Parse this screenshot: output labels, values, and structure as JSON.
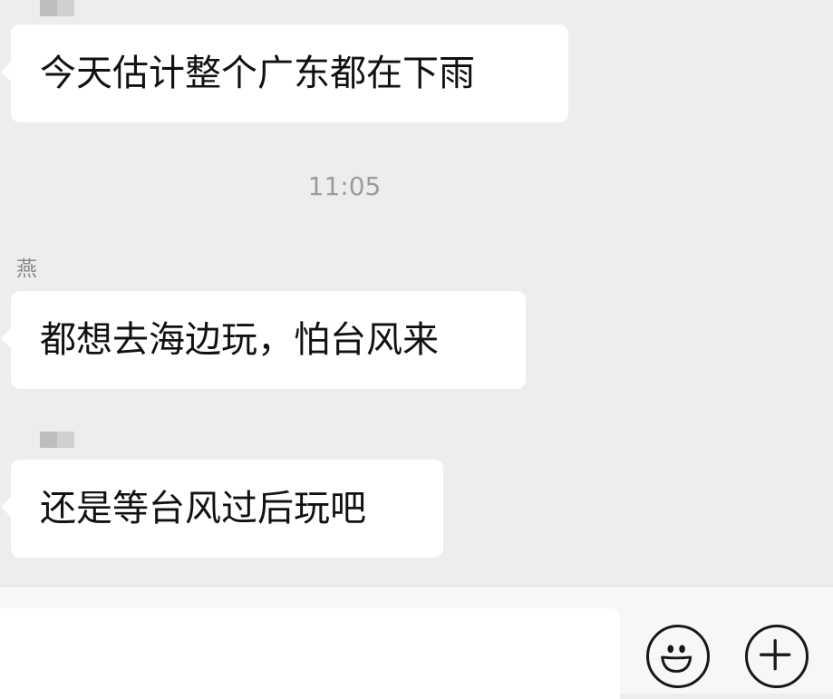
{
  "messages": [
    {
      "sender": "",
      "sender_blurred": true,
      "text": "今天估计整个广东都在下雨"
    },
    {
      "sender": "燕",
      "sender_blurred": false,
      "text": "都想去海边玩，怕台风来"
    },
    {
      "sender": "",
      "sender_blurred": true,
      "text": "还是等台风过后玩吧"
    }
  ],
  "timestamp": "11:05",
  "input": {
    "value": "",
    "placeholder": ""
  },
  "icons": {
    "emoji": "smiley-face-icon",
    "more": "plus-circle-icon"
  },
  "colors": {
    "chat_background": "#ededed",
    "bubble": "#ffffff",
    "timestamp_text": "#9b9b9b"
  }
}
